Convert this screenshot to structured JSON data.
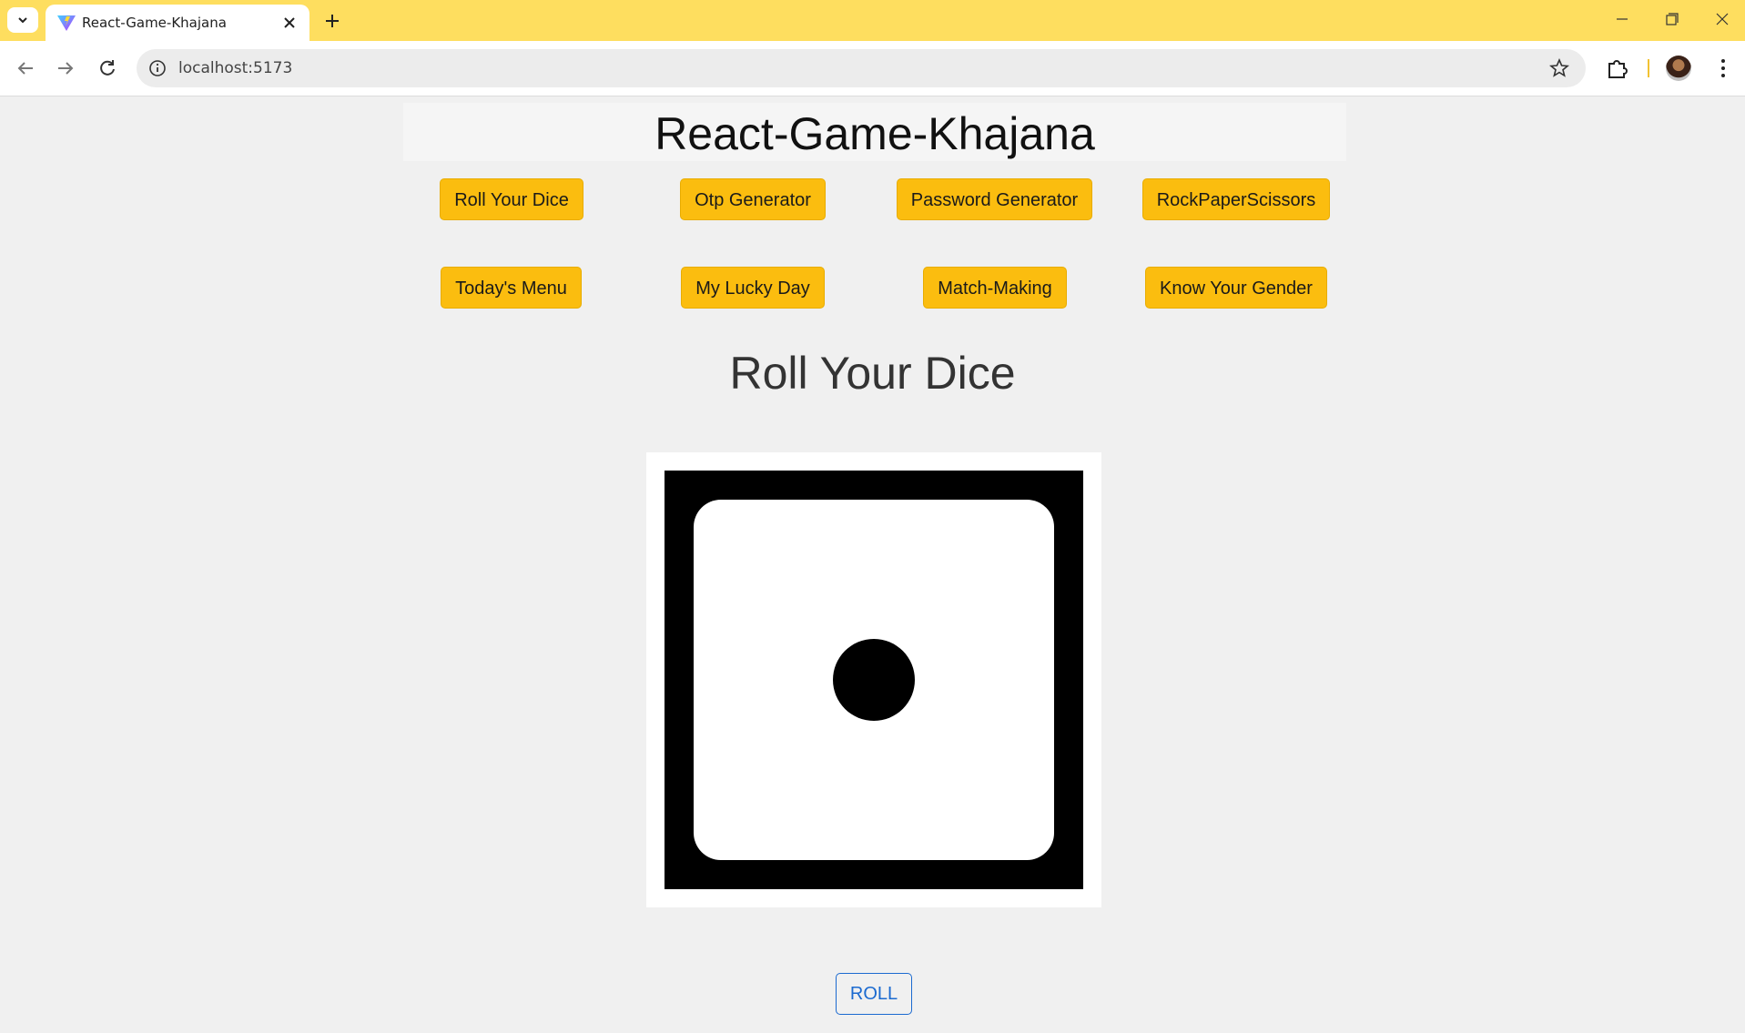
{
  "browser": {
    "tab_title": "React-Game-Khajana",
    "url": "localhost:5173"
  },
  "app": {
    "title": "React-Game-Khajana",
    "nav_row1": [
      "Roll Your Dice",
      "Otp Generator",
      "Password Generator",
      "RockPaperScissors"
    ],
    "nav_row2": [
      "Today's Menu",
      "My Lucky Day",
      "Match-Making",
      "Know Your Gender"
    ]
  },
  "game": {
    "title": "Roll Your Dice",
    "dice_value": 1,
    "roll_label": "ROLL"
  },
  "colors": {
    "tab_strip": "#fede5f",
    "button_accent": "#fbbd0f",
    "roll_button": "#1b6ad0"
  }
}
